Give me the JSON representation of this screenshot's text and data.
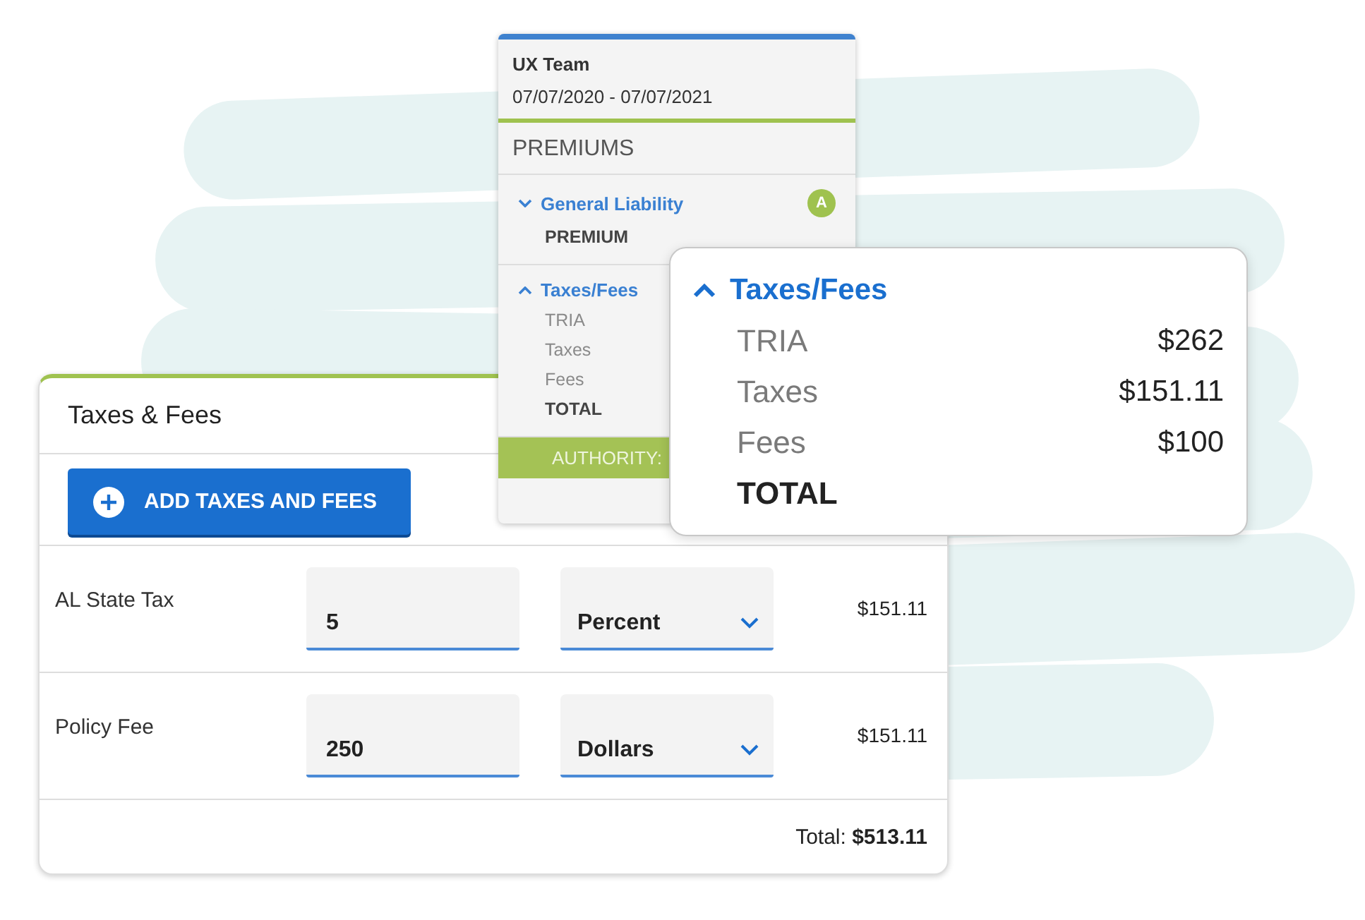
{
  "summary_card": {
    "team": "UX Team",
    "dates": "07/07/2020 - 07/07/2021",
    "section_title": "PREMIUMS",
    "groups": [
      {
        "title": "General Liability",
        "expanded": false,
        "badge": "A",
        "items": [
          {
            "label": "PREMIUM",
            "kind": "total"
          }
        ]
      },
      {
        "title": "Taxes/Fees",
        "expanded": true,
        "items": [
          {
            "label": "TRIA",
            "kind": "line"
          },
          {
            "label": "Taxes",
            "kind": "line"
          },
          {
            "label": "Fees",
            "kind": "line"
          },
          {
            "label": "TOTAL",
            "kind": "total"
          }
        ]
      }
    ],
    "footer": "AUTHORITY:"
  },
  "taxes_card": {
    "title": "Taxes & Fees",
    "add_button": "ADD TAXES AND FEES",
    "rows": [
      {
        "name": "AL State Tax",
        "value": "5",
        "unit": "Percent",
        "amount": "$151.11"
      },
      {
        "name": "Policy Fee",
        "value": "250",
        "unit": "Dollars",
        "amount": "$151.11"
      }
    ],
    "total_label": "Total:",
    "total": "$513.11"
  },
  "popup": {
    "title": "Taxes/Fees",
    "expanded": true,
    "rows": [
      {
        "label": "TRIA",
        "amount": "$262",
        "kind": "line"
      },
      {
        "label": "Taxes",
        "amount": "$151.11",
        "kind": "line"
      },
      {
        "label": "Fees",
        "amount": "$100",
        "kind": "line"
      },
      {
        "label": "TOTAL",
        "kind": "total"
      }
    ]
  }
}
